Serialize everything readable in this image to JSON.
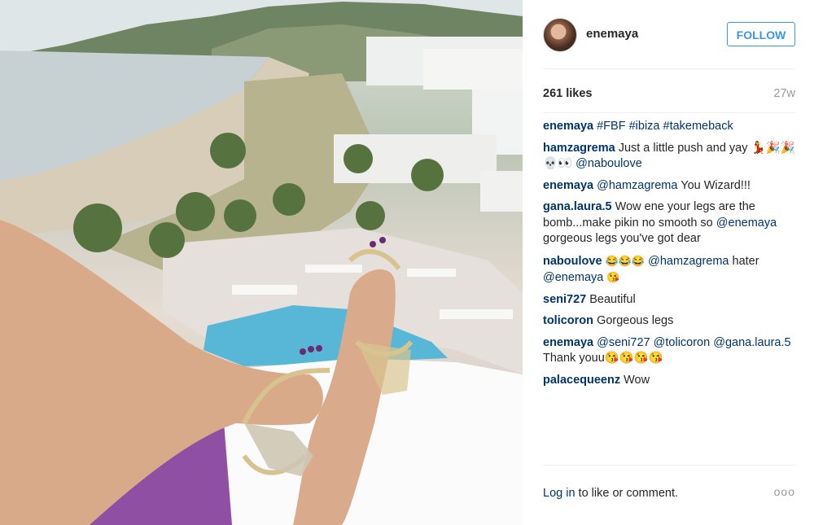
{
  "post": {
    "username": "enemaya",
    "follow_label": "FOLLOW",
    "likes": "261 likes",
    "time_ago": "27w"
  },
  "comments": [
    {
      "user": "enemaya",
      "text": "#FBF #ibiza #takemeback"
    },
    {
      "user": "hamzagrema",
      "text": "Just a little push and yay 💃🎉🎉💀👀",
      "mention": "@naboulove"
    },
    {
      "user": "enemaya",
      "mention": "@hamzagrema",
      "text": "You Wizard!!!"
    },
    {
      "user": "gana.laura.5",
      "text": "Wow ene your legs are the bomb...make pikin no smooth so",
      "mention": "@enemaya",
      "text2": "gorgeous legs you've got dear"
    },
    {
      "user": "naboulove",
      "text": "😂😂😂",
      "mention": "@hamzagrema",
      "text2": "hater",
      "mention2": "@enemaya",
      "text3": "😘"
    },
    {
      "user": "seni727",
      "text": "Beautiful"
    },
    {
      "user": "tolicoron",
      "text": "Gorgeous legs"
    },
    {
      "user": "enemaya",
      "mention": "@seni727",
      "mention2": "@tolicoron",
      "mention3": "@gana.laura.5",
      "text": "Thank youu😘😘😘😘"
    },
    {
      "user": "palacequeenz",
      "text": "Wow"
    }
  ],
  "footer": {
    "login_link": "Log in",
    "login_text": " to like or comment.",
    "more_icon": "ooo"
  },
  "colors": {
    "accent": "#3897f0",
    "link": "#003569"
  }
}
